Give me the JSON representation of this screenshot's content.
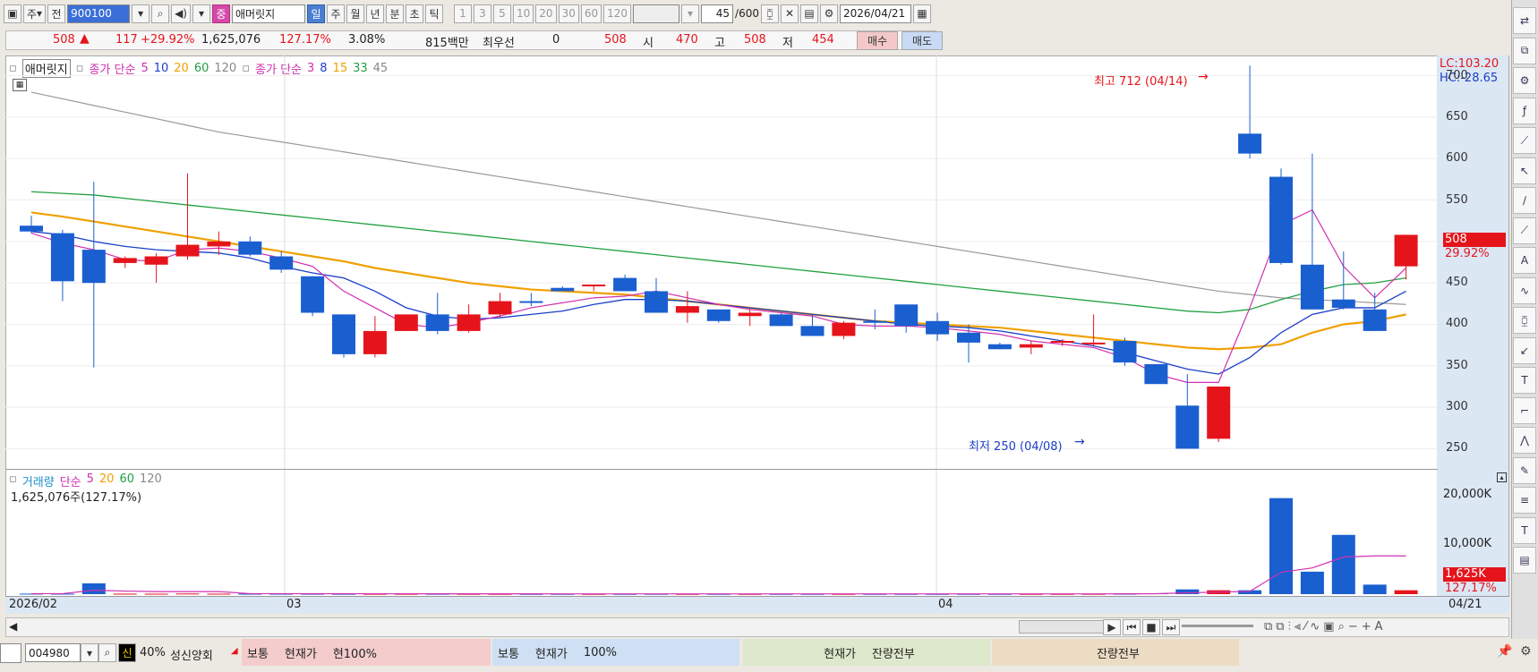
{
  "toolbar": {
    "btn_ju": "주",
    "btn_jeon": "전",
    "code": "900100",
    "stock_badge": "중",
    "stock_name": "애머릿지",
    "periods": [
      "일",
      "주",
      "월",
      "년",
      "분",
      "초",
      "틱"
    ],
    "intervals": [
      "1",
      "3",
      "5",
      "10",
      "20",
      "30",
      "60",
      "120"
    ],
    "count": "45",
    "count_total": "/600",
    "date": "2026/04/21"
  },
  "info": {
    "price": "508",
    "change": "117",
    "change_pct": "+29.92%",
    "volume": "1,625,076",
    "vol_ratio": "127.17%",
    "turnover": "3.08%",
    "amount": "815백만",
    "best_label": "최우선",
    "best_val": "0",
    "best_price": "508",
    "open_label": "시",
    "open": "470",
    "high_label": "고",
    "high": "508",
    "low_label": "저",
    "low": "454",
    "buy": "매수",
    "sell": "매도"
  },
  "legend": {
    "name": "애머릿지",
    "ma1_label": "종가 단순",
    "ma1": [
      "5",
      "10",
      "20",
      "60",
      "120"
    ],
    "ma2_label": "종가 단순",
    "ma2": [
      "3",
      "8",
      "15",
      "33",
      "45"
    ]
  },
  "price_panel": {
    "lc": "LC:103.20",
    "hc": "HC:-28.65",
    "last_price": "508",
    "last_pct": "29.92%",
    "high_note": "최고 712 (04/14)",
    "low_note": "최저 250 (04/08)",
    "yticks": [
      "700",
      "650",
      "600",
      "550",
      "500",
      "450",
      "400",
      "350",
      "300",
      "250"
    ]
  },
  "volume_panel": {
    "label": "거래량",
    "ma_label": "단순",
    "ma": [
      "5",
      "20",
      "60",
      "120"
    ],
    "current": "1,625,076주(127.17%)",
    "yticks": [
      "20,000K",
      "10,000K"
    ],
    "last_vol": "1,625K",
    "last_pct": "127.17%"
  },
  "xaxis": {
    "labels": [
      "2026/02",
      "03",
      "04",
      "04/21"
    ]
  },
  "bottom": {
    "code": "004980",
    "badge": "신",
    "ratio": "40%",
    "name": "성신양회",
    "panel1": [
      "보통",
      "현재가",
      "현100%"
    ],
    "panel2": [
      "보통",
      "현재가",
      "100%"
    ],
    "panel3": [
      "현재가",
      "잔량전부"
    ],
    "panel4": [
      "잔량전부"
    ]
  },
  "chart_data": {
    "type": "candlestick",
    "ohlc": [
      [
        519,
        531,
        510,
        512
      ],
      [
        510,
        514,
        428,
        452
      ],
      [
        490,
        572,
        348,
        450
      ],
      [
        474,
        482,
        468,
        480
      ],
      [
        472,
        486,
        450,
        482
      ],
      [
        482,
        582,
        478,
        496
      ],
      [
        494,
        512,
        484,
        500
      ],
      [
        500,
        506,
        482,
        484
      ],
      [
        482,
        488,
        462,
        466
      ],
      [
        458,
        458,
        410,
        414
      ],
      [
        412,
        412,
        360,
        364
      ],
      [
        364,
        410,
        360,
        392
      ],
      [
        392,
        412,
        392,
        412
      ],
      [
        412,
        438,
        388,
        392
      ],
      [
        392,
        424,
        390,
        412
      ],
      [
        412,
        438,
        408,
        428
      ],
      [
        428,
        438,
        422,
        426
      ],
      [
        444,
        446,
        440,
        440
      ],
      [
        448,
        448,
        440,
        448
      ],
      [
        456,
        460,
        440,
        440
      ],
      [
        440,
        456,
        414,
        414
      ],
      [
        414,
        440,
        402,
        422
      ],
      [
        418,
        418,
        402,
        404
      ],
      [
        410,
        418,
        398,
        414
      ],
      [
        412,
        414,
        398,
        398
      ],
      [
        398,
        412,
        388,
        386
      ],
      [
        386,
        404,
        382,
        402
      ],
      [
        404,
        418,
        394,
        402
      ],
      [
        424,
        424,
        390,
        398
      ],
      [
        404,
        414,
        380,
        388
      ],
      [
        390,
        400,
        354,
        378
      ],
      [
        376,
        378,
        370,
        370
      ],
      [
        372,
        380,
        364,
        376
      ],
      [
        380,
        382,
        374,
        380
      ],
      [
        376,
        412,
        374,
        378
      ],
      [
        380,
        384,
        350,
        354
      ],
      [
        352,
        352,
        328,
        328
      ],
      [
        302,
        340,
        250,
        250
      ],
      [
        262,
        325,
        258,
        325
      ],
      [
        630,
        712,
        600,
        606
      ],
      [
        578,
        588,
        472,
        474
      ],
      [
        472,
        606,
        420,
        418
      ],
      [
        430,
        488,
        418,
        420
      ],
      [
        418,
        438,
        392,
        392
      ],
      [
        470,
        508,
        454,
        508
      ]
    ],
    "volume_k": [
      120,
      110,
      2500,
      120,
      100,
      150,
      110,
      100,
      100,
      90,
      80,
      80,
      80,
      80,
      70,
      70,
      60,
      60,
      60,
      60,
      70,
      60,
      60,
      60,
      60,
      60,
      60,
      60,
      60,
      60,
      60,
      60,
      60,
      60,
      70,
      100,
      200,
      1100,
      900,
      900,
      22200,
      5200,
      13700,
      2200,
      900,
      1625
    ],
    "ma5": [
      510,
      498,
      490,
      478,
      476,
      490,
      492,
      488,
      480,
      470,
      440,
      420,
      400,
      396,
      402,
      410,
      420,
      426,
      432,
      434,
      440,
      432,
      424,
      418,
      414,
      410,
      400,
      398,
      398,
      396,
      392,
      388,
      380,
      376,
      372,
      360,
      340,
      330,
      330,
      420,
      520,
      538,
      470,
      432,
      468
    ],
    "ma10": [
      512,
      508,
      500,
      494,
      490,
      488,
      486,
      480,
      470,
      462,
      456,
      440,
      420,
      410,
      406,
      408,
      412,
      416,
      424,
      430,
      430,
      428,
      424,
      420,
      416,
      412,
      408,
      404,
      400,
      398,
      396,
      392,
      386,
      380,
      374,
      366,
      356,
      346,
      340,
      360,
      390,
      412,
      420,
      420,
      440
    ],
    "ma20": [
      535,
      530,
      524,
      518,
      512,
      506,
      500,
      494,
      488,
      482,
      476,
      468,
      462,
      456,
      450,
      446,
      442,
      440,
      438,
      436,
      432,
      428,
      424,
      420,
      416,
      412,
      408,
      404,
      402,
      400,
      398,
      396,
      392,
      388,
      384,
      380,
      376,
      372,
      370,
      372,
      376,
      390,
      400,
      404,
      412
    ],
    "ma60": [
      560,
      558,
      556,
      552,
      548,
      544,
      540,
      536,
      532,
      528,
      524,
      520,
      516,
      512,
      508,
      504,
      500,
      496,
      492,
      488,
      484,
      480,
      476,
      472,
      468,
      464,
      460,
      456,
      452,
      448,
      444,
      440,
      436,
      432,
      428,
      424,
      420,
      416,
      414,
      418,
      430,
      440,
      448,
      450,
      456
    ],
    "ma120": [
      680,
      672,
      664,
      656,
      648,
      640,
      632,
      626,
      620,
      614,
      608,
      602,
      596,
      590,
      584,
      578,
      572,
      566,
      560,
      554,
      548,
      542,
      536,
      530,
      524,
      518,
      512,
      506,
      500,
      494,
      488,
      482,
      476,
      470,
      464,
      458,
      452,
      446,
      440,
      436,
      432,
      430,
      428,
      426,
      424
    ],
    "ylim": [
      230,
      720
    ],
    "vol_ylim": [
      0,
      24000
    ]
  }
}
